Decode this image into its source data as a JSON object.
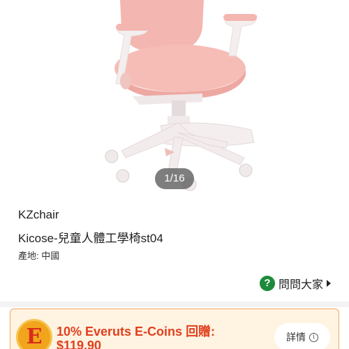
{
  "product": {
    "image_counter": "1/16",
    "brand": "KZchair",
    "title": "Kicose-兒童人體工學椅st04",
    "origin": "產地: 中國"
  },
  "ask": {
    "icon": "question-icon",
    "label": "問問大家"
  },
  "promo": {
    "icon": "everuts-coin-icon",
    "line1": "10% Everuts E-Coins 回贈:",
    "line2": "$119.90",
    "details_label": "詳情",
    "details_icon": "info-icon"
  },
  "colors": {
    "chair_pink": "#f4b6b0",
    "chair_frame": "#f4eeee",
    "promo_text": "#e0401e",
    "promo_bg": "#fff3e2",
    "ask_icon": "#1e8a3c"
  }
}
